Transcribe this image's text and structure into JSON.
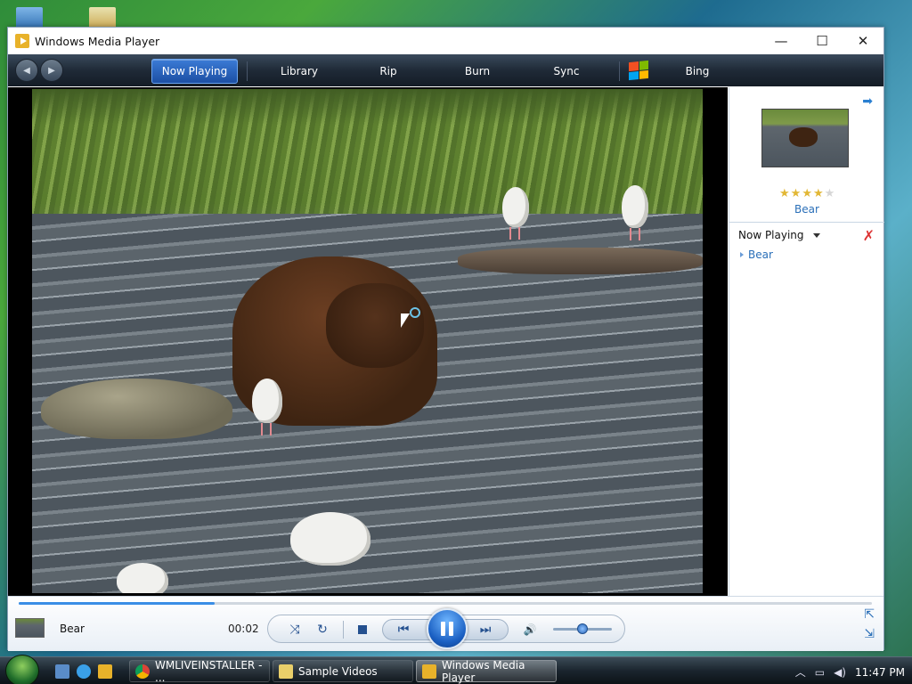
{
  "window": {
    "title": "Windows Media Player",
    "controls": {
      "minimize": "—",
      "maximize": "☐",
      "close": "✕"
    }
  },
  "nav": {
    "back": "◀",
    "forward": "▶",
    "tabs": [
      {
        "label": "Now Playing",
        "active": true
      },
      {
        "label": "Library"
      },
      {
        "label": "Rip"
      },
      {
        "label": "Burn"
      },
      {
        "label": "Sync"
      },
      {
        "label": "Bing"
      }
    ]
  },
  "side_pane": {
    "arrow": "➡",
    "thumbnail_title": "Bear",
    "rating": {
      "filled": 4,
      "total": 5
    },
    "now_playing_label": "Now Playing",
    "clear_icon": "✗",
    "playlist": [
      "Bear"
    ]
  },
  "controls": {
    "title": "Bear",
    "elapsed": "00:02",
    "seek_fraction": 0.23,
    "volume_fraction": 0.5,
    "shuffle": "⤨",
    "repeat": "↻",
    "prev": "⏮",
    "next": "⏭",
    "volume": "🔊"
  },
  "taskbar": {
    "buttons": [
      {
        "label": "WMLIVEINSTALLER - ..."
      },
      {
        "label": "Sample Videos"
      },
      {
        "label": "Windows Media Player",
        "active": true
      }
    ],
    "time": "11:47 PM"
  },
  "colors": {
    "accent": "#1c4fa3",
    "link": "#2a6fb8",
    "nav_bg": "#1f2a37"
  }
}
